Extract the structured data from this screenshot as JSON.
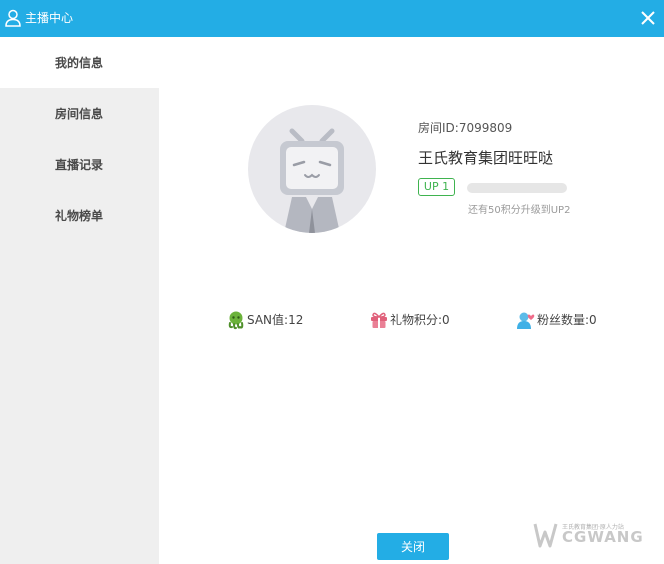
{
  "window": {
    "title": "主播中心",
    "title_icon": "user-icon",
    "close_icon": "close-icon"
  },
  "sidebar": {
    "items": [
      {
        "label": "我的信息",
        "active": true
      },
      {
        "label": "房间信息",
        "active": false
      },
      {
        "label": "直播记录",
        "active": false
      },
      {
        "label": "礼物榜单",
        "active": false
      }
    ]
  },
  "profile": {
    "avatar_icon": "tv-mascot-avatar-icon",
    "room_id": "房间ID:7099809",
    "nickname": "王氏教育集团旺旺哒",
    "level": "UP 1",
    "progress_fraction": 0,
    "upgrade_hint": "还有50积分升级到UP2"
  },
  "stats": [
    {
      "icon": "octopus-icon",
      "text": "SAN值:12",
      "color": "#5aa632"
    },
    {
      "icon": "gift-icon",
      "text": "礼物积分:0",
      "color": "#e0607a"
    },
    {
      "icon": "fans-icon",
      "text": "粉丝数量:0",
      "color": "#3fb0e6"
    }
  ],
  "footer": {
    "close_label": "关闭"
  },
  "watermark": {
    "sub": "王氏教育集团·原人力站",
    "main": "CGWANG"
  },
  "colors": {
    "accent": "#23ade5",
    "level_green": "#3fb34f",
    "sidebar_bg": "#efefef"
  }
}
